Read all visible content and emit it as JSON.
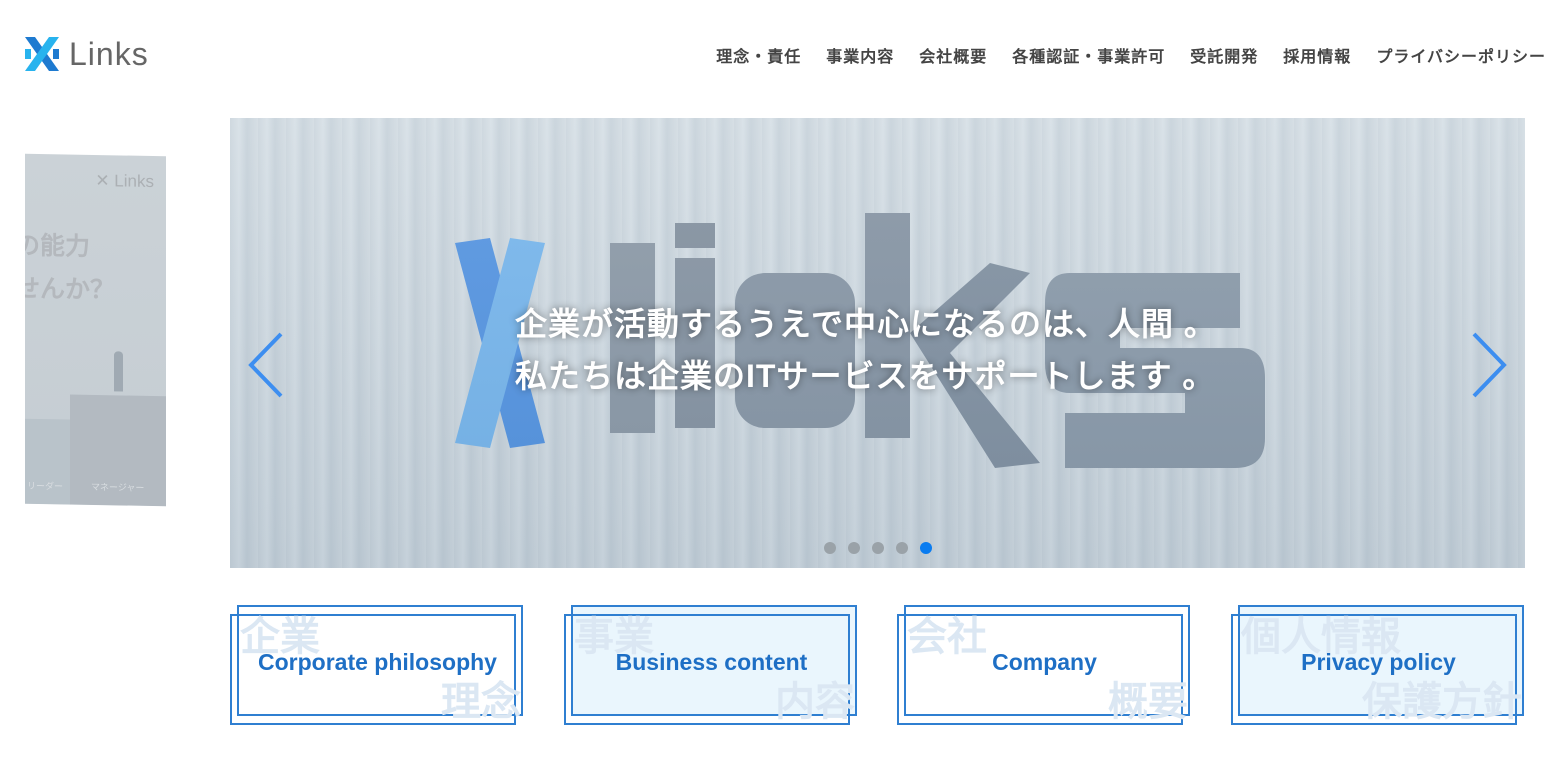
{
  "header": {
    "logo_text": "Links",
    "nav": [
      {
        "label": "理念・責任"
      },
      {
        "label": "事業内容"
      },
      {
        "label": "会社概要"
      },
      {
        "label": "各種認証・事業許可"
      },
      {
        "label": "受託開発"
      },
      {
        "label": "採用情報"
      },
      {
        "label": "プライバシーポリシー"
      }
    ]
  },
  "side_banner": {
    "logo_text": "Links",
    "text_line1": "能力",
    "text_line2": "せんか？",
    "label_1": "リーダー",
    "label_2": "マネージャー"
  },
  "hero": {
    "sign_image_text": "Links",
    "headline_line1": "企業が活動するうえで中心になるのは、人間 。",
    "headline_line2": "私たちは企業のITサービスをサポートします 。",
    "slide_count": 5,
    "active_slide": 5
  },
  "cards": [
    {
      "label": "Corporate philosophy",
      "bg_top": "企業",
      "bg_bottom": "理念"
    },
    {
      "label": "Business content",
      "bg_top": "事業",
      "bg_bottom": "内容"
    },
    {
      "label": "Company",
      "bg_top": "会社",
      "bg_bottom": "概要"
    },
    {
      "label": "Privacy policy",
      "bg_top": "個人情報",
      "bg_bottom": "保護方針"
    }
  ],
  "colors": {
    "accent": "#1e6fc5",
    "active_dot": "#0a7cf0",
    "nav_text": "#444444"
  }
}
